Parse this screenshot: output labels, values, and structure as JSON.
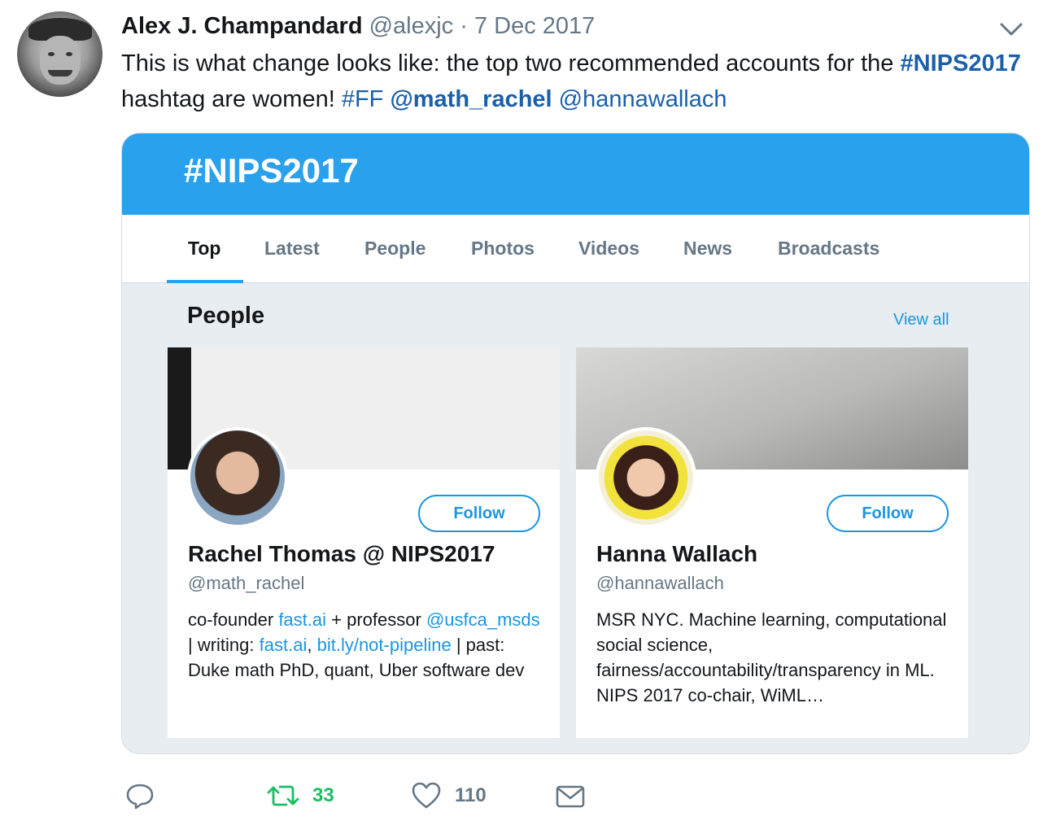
{
  "tweet": {
    "author_name": "Alex J. Champandard",
    "author_handle": "@alexjc",
    "separator": "·",
    "date": "7 Dec 2017",
    "text_1": "This is what change looks like: the top two recommended accounts for the",
    "hashtag_nips": "#NIPS2017",
    "text_2": "hashtag are women!",
    "hashtag_ff": "#FF",
    "mention_1": "@math_rachel",
    "mention_2": "@hannawallach"
  },
  "card": {
    "title": "#NIPS2017",
    "tabs": [
      {
        "label": "Top"
      },
      {
        "label": "Latest"
      },
      {
        "label": "People"
      },
      {
        "label": "Photos"
      },
      {
        "label": "Videos"
      },
      {
        "label": "News"
      },
      {
        "label": "Broadcasts"
      }
    ],
    "section_title": "People",
    "view_all": "View all",
    "people": [
      {
        "name": "Rachel Thomas @ NIPS2017",
        "handle": "@math_rachel",
        "follow_label": "Follow",
        "bio": {
          "t1": "co-founder",
          "l1": "fast.ai",
          "t2": "+ professor",
          "l2": "@usfca_msds",
          "t3": "| writing:",
          "l3": "fast.ai",
          "t4": ",",
          "l4": "bit.ly/not-pipeline",
          "t5": "| past: Duke math PhD, quant, Uber software dev"
        }
      },
      {
        "name": "Hanna Wallach",
        "handle": "@hannawallach",
        "follow_label": "Follow",
        "bio_text": "MSR NYC. Machine learning, computational social science, fairness/accountability/transparency in ML. NIPS 2017 co-chair, WiML…"
      }
    ]
  },
  "actions": {
    "reply_icon": "reply-icon",
    "retweet_icon": "retweet-icon",
    "retweet_count": "33",
    "like_icon": "heart-icon",
    "like_count": "110",
    "message_icon": "envelope-icon"
  },
  "colors": {
    "banner": "#2aa1ec",
    "link": "#1b95e0",
    "retweet_green": "#17bf63",
    "muted": "#657786"
  }
}
